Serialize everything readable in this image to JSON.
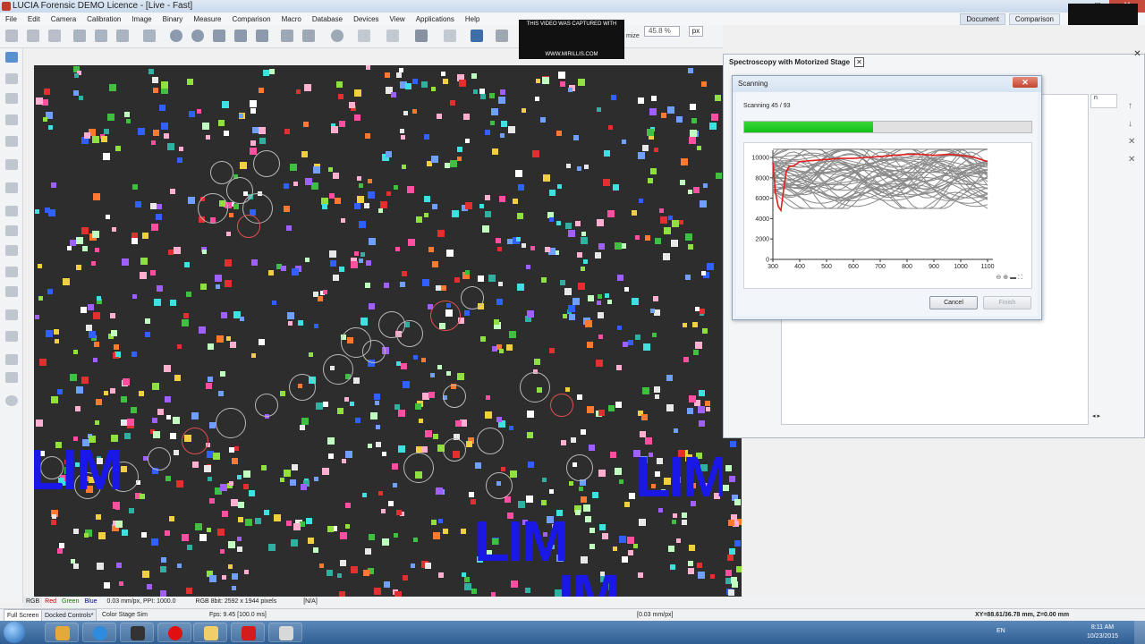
{
  "window": {
    "title": "LUCIA Forensic DEMO Licence - [Live - Fast]"
  },
  "menu": {
    "items": [
      "File",
      "Edit",
      "Camera",
      "Calibration",
      "Image",
      "Binary",
      "Measure",
      "Comparison",
      "Macro",
      "Database",
      "Devices",
      "View",
      "Applications",
      "Help"
    ],
    "right_tabs": [
      "Document",
      "Comparison"
    ]
  },
  "toolbar": {
    "zoom": "45.8 %",
    "unit": "px",
    "optimize": "mize"
  },
  "watermark": {
    "top": "THIS VIDEO WAS CAPTURED WITH",
    "bottom": "WWW.MIRILLIS.COM"
  },
  "image": {
    "labels": [
      "LIM",
      "LIM",
      "LIM",
      "IM"
    ]
  },
  "channelbar": {
    "channels": [
      "RGB",
      "Red",
      "Green",
      "Blue"
    ],
    "scale": "0.03 mm/px, PPI: 1000.0",
    "format": "RGB 8bit: 2592 x 1944 pixels",
    "na": "[N/A]"
  },
  "statusbar": {
    "tab_fullscreen": "Full Screen",
    "tab_docked": "Docked Controls*",
    "stage": "Color Stage Sim",
    "fps": "Fps: 9.45 [100.0 ms]",
    "scale_right": "[0.03 mm/px]",
    "coords": "XY=88.61/36.78 mm, Z=0.00 mm"
  },
  "spectro_panel": {
    "title": "Spectroscopy with Motorized Stage",
    "column_header": "n"
  },
  "scan_dialog": {
    "title": "Scanning",
    "status": "Scanning 45 / 93",
    "progress": 0.45,
    "cancel_label": "Cancel",
    "finish_label": "Finish"
  },
  "chart_data": {
    "type": "line",
    "x_ticks": [
      "300",
      "400",
      "500",
      "600",
      "700",
      "800",
      "900",
      "1000",
      "1100"
    ],
    "y_ticks": [
      "0",
      "2000",
      "4000",
      "6000",
      "8000",
      "10000"
    ],
    "xlim": [
      300,
      1100
    ],
    "ylim": [
      0,
      10000
    ],
    "series_gray_count": 44,
    "highlight_series": {
      "color": "#e02020",
      "x": [
        300,
        310,
        320,
        330,
        340,
        350,
        360,
        380,
        400,
        450,
        500,
        550,
        600,
        650,
        700,
        750,
        800,
        850,
        900,
        950,
        1000,
        1050,
        1100
      ],
      "y": [
        9500,
        6500,
        5200,
        4800,
        6800,
        8600,
        9100,
        9200,
        9600,
        9700,
        9800,
        9900,
        9900,
        10000,
        10100,
        10200,
        10300,
        10300,
        10200,
        10300,
        10200,
        10000,
        9600
      ]
    },
    "band": {
      "min": 5000,
      "max": 10800
    }
  },
  "taskbar": {
    "lang": "EN",
    "time": "8:11 AM",
    "date": "10/23/2015"
  },
  "colors": {
    "accent": "#0fbf18",
    "lim_blue": "#1a18e6",
    "viewport_bg": "#2d2d2d"
  }
}
